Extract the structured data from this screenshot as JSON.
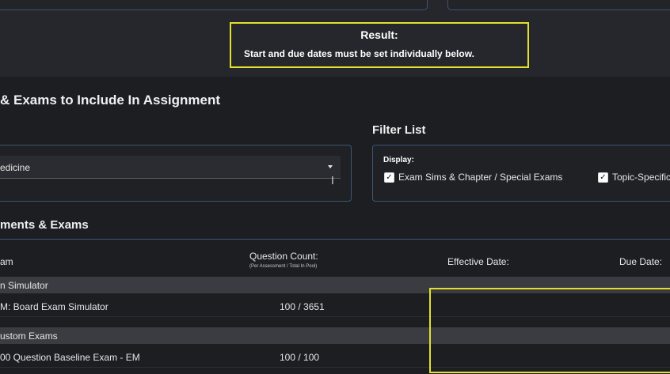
{
  "result": {
    "title": "Result:",
    "message": "Start and due dates must be set individually below."
  },
  "section_title": "& Exams to Include In Assignment",
  "source": {
    "selected_value": "edicine"
  },
  "filter": {
    "title": "Filter List",
    "display_label": "Display:",
    "options": [
      {
        "label": "Exam Sims & Chapter / Special Exams",
        "checked": true
      },
      {
        "label": "Topic-Specific",
        "checked": true
      }
    ]
  },
  "list": {
    "title": "ments & Exams",
    "columns": {
      "name": "am",
      "question_count": "Question Count:",
      "question_count_sub": "(Per Assessment / Total In Pool)",
      "effective_date": "Effective Date:",
      "due_date": "Due Date:"
    },
    "groups": [
      {
        "label": "n Simulator",
        "rows": [
          {
            "name": "M: Board Exam Simulator",
            "count": "100 / 3651"
          }
        ]
      },
      {
        "label": "ustom Exams",
        "rows": [
          {
            "name": "00 Question Baseline Exam - EM",
            "count": "100 / 100"
          }
        ]
      }
    ]
  },
  "colors": {
    "highlight": "#e3e02c",
    "panel_border": "#3e5576",
    "background": "#1c1e22"
  }
}
